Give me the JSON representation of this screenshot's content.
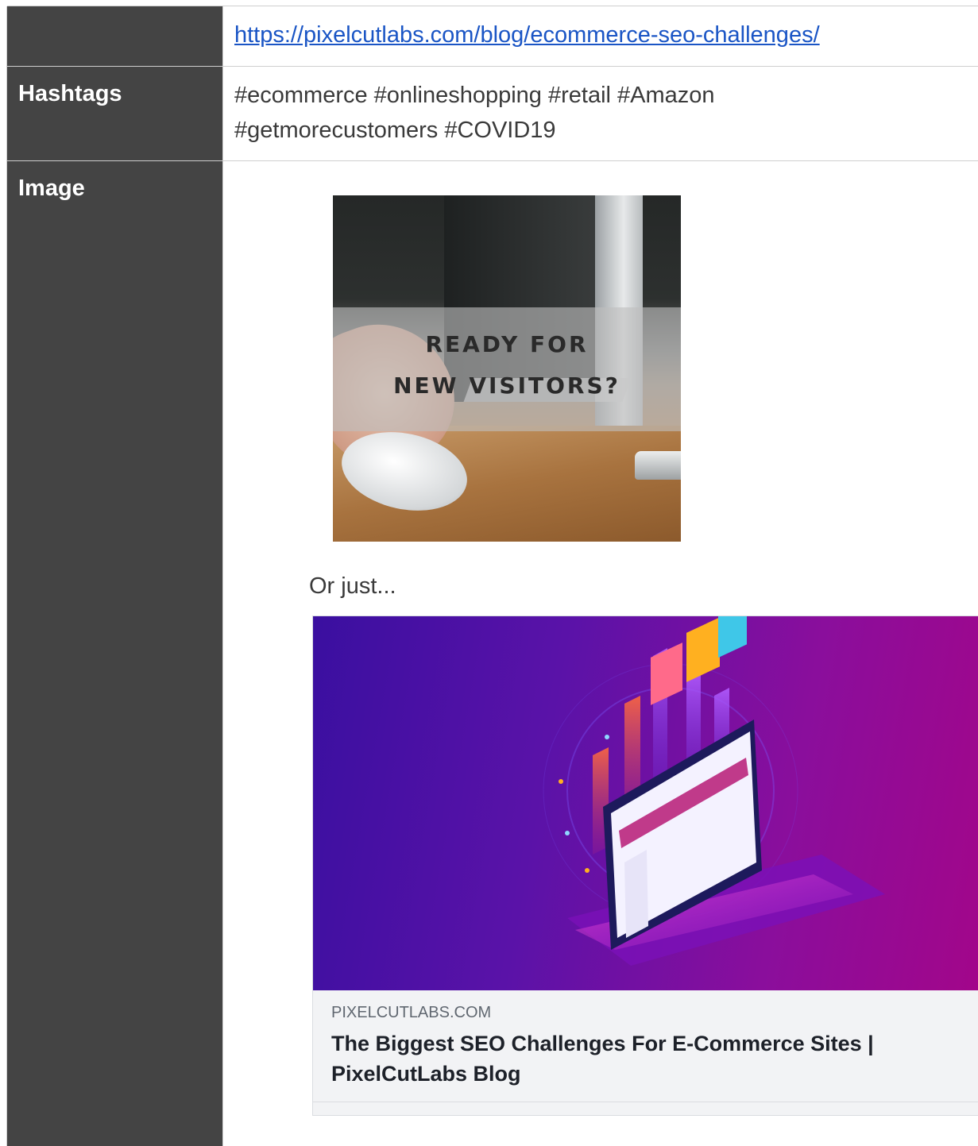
{
  "rows": {
    "link": {
      "label": "",
      "url_text": "https://pixelcutlabs.com/blog/ecommerce-seo-challenges/"
    },
    "hashtags": {
      "label": "Hashtags",
      "line1": "#ecommerce #onlineshopping #retail #Amazon",
      "line2": "#getmorecustomers #COVID19"
    },
    "image": {
      "label": "Image",
      "photo_line1": "READY FOR",
      "photo_line2": "NEW VISITORS?",
      "or_just": "Or just...",
      "card": {
        "domain": "PIXELCUTLABS.COM",
        "title": "The Biggest SEO Challenges For E-Commerce Sites | PixelCutLabs Blog"
      }
    }
  },
  "colors": {
    "label_bg": "#444444",
    "link": "#1a55c5",
    "border": "#cfcfcf"
  }
}
